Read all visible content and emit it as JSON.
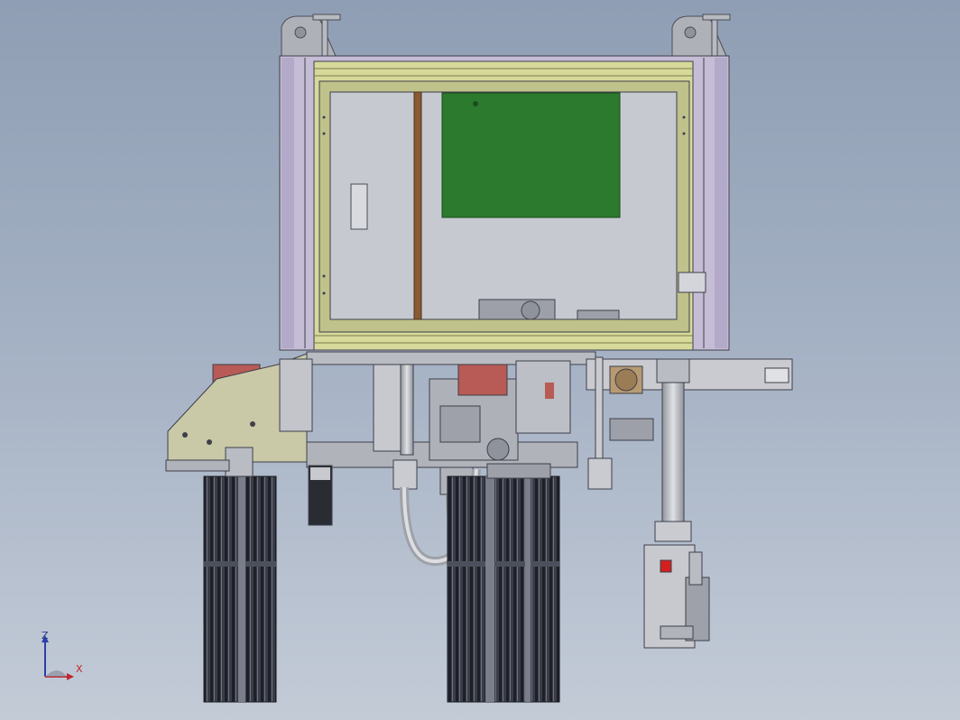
{
  "viewport": {
    "background_top": "#8f9eb4",
    "background_bottom": "#c3cbd7"
  },
  "model": {
    "frame_color": "#c5bcd5",
    "inner_frame_color": "#d6d99a",
    "panel_color": "#c7c9d1",
    "pcb_color": "#2b7a2e",
    "metal_color": "#b9bcc2",
    "pipe_color": "#c4c7cb",
    "filter_color": "#2f323a",
    "accent_red": "#b85a55"
  },
  "triad": {
    "z_label": "Z",
    "x_label": "X",
    "z_color": "#2d3fa8",
    "x_color": "#c0282d"
  }
}
